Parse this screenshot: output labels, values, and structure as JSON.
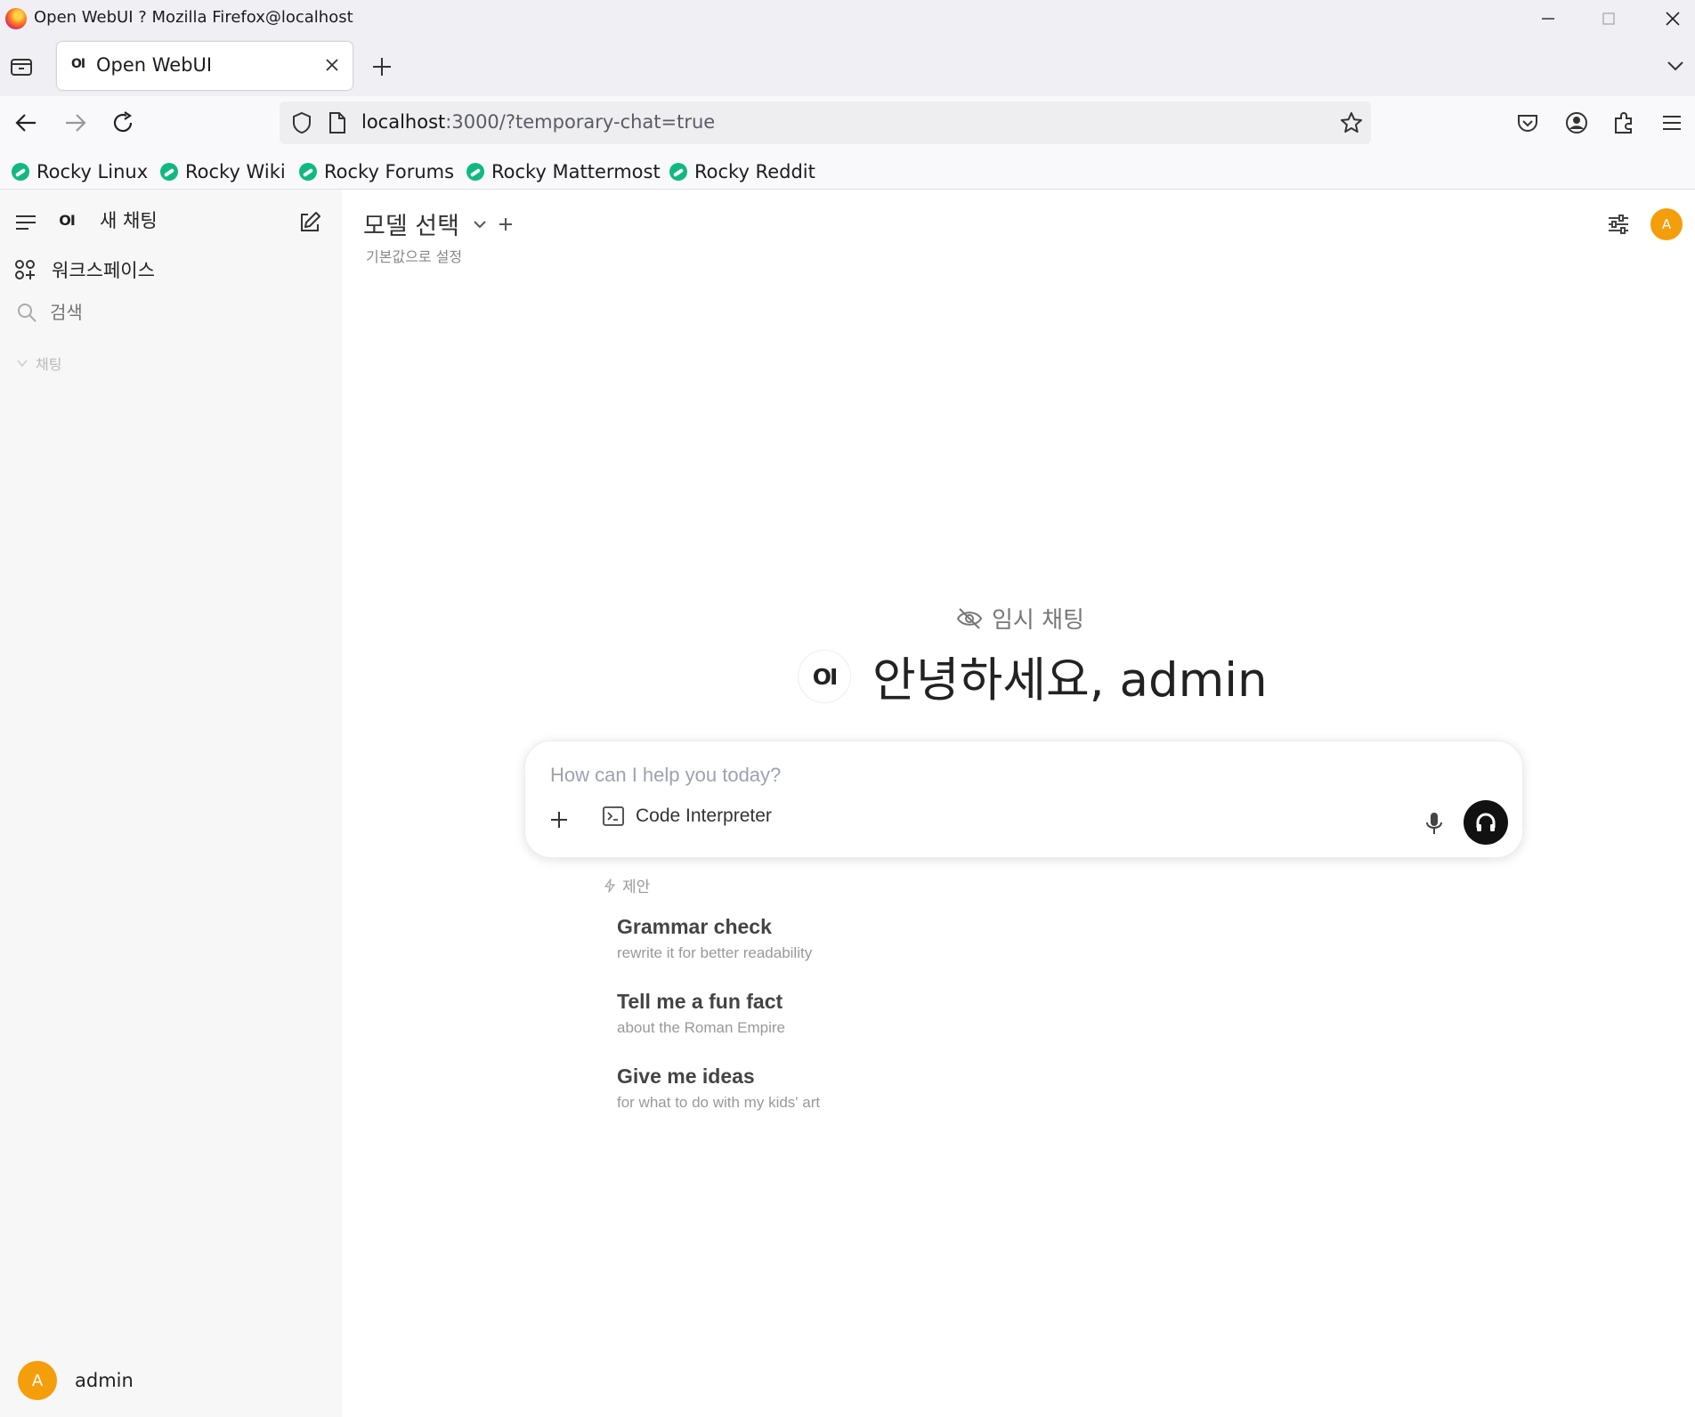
{
  "window": {
    "title": "Open WebUI ? Mozilla Firefox@localhost"
  },
  "browser": {
    "tab": {
      "label": "Open WebUI",
      "favicon": "OI"
    },
    "url": {
      "host": "localhost",
      "rest": ":3000/?temporary-chat=true"
    },
    "bookmarks": [
      "Rocky Linux",
      "Rocky Wiki",
      "Rocky Forums",
      "Rocky Mattermost",
      "Rocky Reddit"
    ]
  },
  "sidebar": {
    "logo": "OI",
    "new_chat": "새 채팅",
    "workspace": "워크스페이스",
    "search_placeholder": "검색",
    "section_chats": "채팅",
    "user": {
      "initial": "A",
      "name": "admin"
    }
  },
  "header": {
    "model_select": "모델 선택",
    "set_default": "기본값으로 설정",
    "avatar_initial": "A"
  },
  "main": {
    "temp_chat": "임시 채팅",
    "logo": "OI",
    "greeting": "안녕하세요, admin",
    "composer": {
      "placeholder": "How can I help you today?",
      "value": "",
      "code_interpreter": "Code Interpreter"
    },
    "suggestions_label": "제안",
    "suggestions": [
      {
        "title": "Grammar check",
        "subtitle": "rewrite it for better readability"
      },
      {
        "title": "Tell me a fun fact",
        "subtitle": "about the Roman Empire"
      },
      {
        "title": "Give me ideas",
        "subtitle": "for what to do with my kids' art"
      }
    ]
  },
  "colors": {
    "avatar": "#f59e0b",
    "bookmark_icon": "#10b981",
    "send_button": "#111111"
  }
}
